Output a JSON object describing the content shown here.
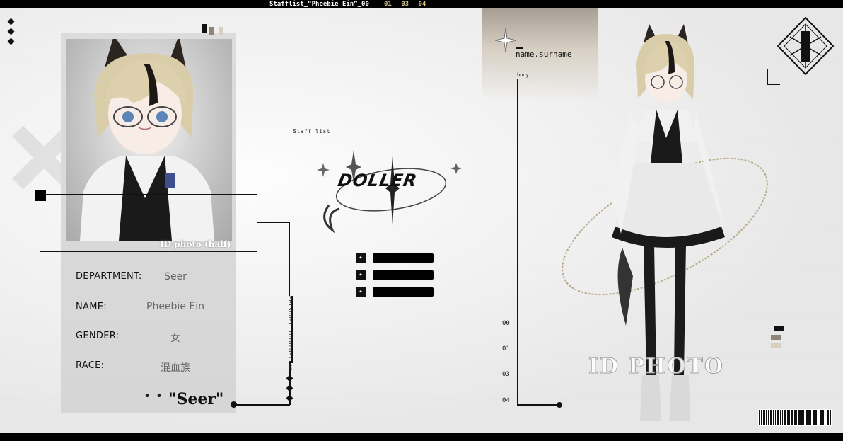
{
  "header": {
    "title": "Stafflist_“Pheebie Ein”_00",
    "numbers": "01 03 04"
  },
  "card": {
    "photo_label": "ID photo (half)",
    "fields": [
      {
        "label": "DEPARTMENT:",
        "value": "Seer"
      },
      {
        "label": "NAME:",
        "value": "Pheebie Ein"
      },
      {
        "label": "GENDER:",
        "value": "女"
      },
      {
        "label": "RACE:",
        "value": "混血族"
      }
    ],
    "quote_marks": "• •",
    "quote": "\"Seer\"",
    "vertical_text": "Personal information"
  },
  "center": {
    "stafflist_label": "Staff list",
    "logo_text": "DOLLER",
    "bars": [
      {
        "icon": "sparkle-icon"
      },
      {
        "icon": "sparkle-icon"
      },
      {
        "icon": "sparkle-icon"
      }
    ]
  },
  "right_column": {
    "name_label": "name.surname",
    "body_label": "body",
    "numbers": [
      "00",
      "01",
      "03",
      "04"
    ]
  },
  "full_body": {
    "label": "ID PHOTO"
  },
  "colors": {
    "background": "#e9e9e9",
    "black": "#000000",
    "swatch_dark": "#111111",
    "swatch_brown": "#8f8576",
    "swatch_beige": "#d9cfbf",
    "accent_gold": "#d8c58a"
  }
}
